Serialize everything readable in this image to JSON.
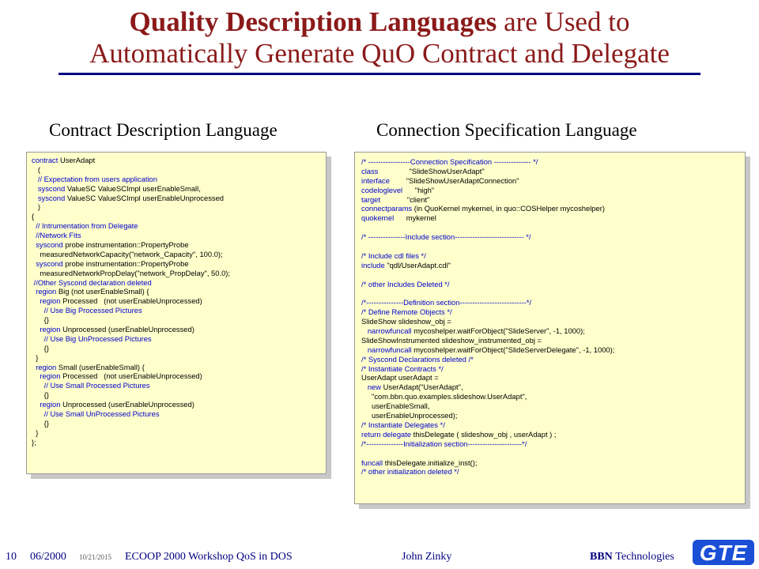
{
  "slide": {
    "title_bold": "Quality Description Languages",
    "title_rest": "are Used to",
    "title_line2": "Automatically Generate QuO Contract and Delegate"
  },
  "left": {
    "heading": "Contract Description Language",
    "lines": [
      [
        [
          "kw",
          "contract "
        ],
        [
          "pl",
          "UserAdapt"
        ]
      ],
      [
        [
          "pl",
          "   ("
        ]
      ],
      [
        [
          "cm",
          "   // Expectation from users application"
        ]
      ],
      [
        [
          "kw",
          "   syscond "
        ],
        [
          "pl",
          "ValueSC ValueSCImpl userEnableSmall,"
        ]
      ],
      [
        [
          "kw",
          "   syscond "
        ],
        [
          "pl",
          "ValueSC ValueSCImpl userEnableUnprocessed"
        ]
      ],
      [
        [
          "pl",
          "   )"
        ]
      ],
      [
        [
          "pl",
          "{"
        ]
      ],
      [
        [
          "cm",
          "  // Intrumentation from Delegate"
        ]
      ],
      [
        [
          "cm",
          "  //Network Fits"
        ]
      ],
      [
        [
          "kw",
          "  syscond "
        ],
        [
          "pl",
          "probe instrumentation::PropertyProbe"
        ]
      ],
      [
        [
          "pl",
          "    measuredNetworkCapacity(\"network_Capacity\", 100.0);"
        ]
      ],
      [
        [
          "kw",
          "  syscond "
        ],
        [
          "pl",
          "probe instrumentation::PropertyProbe"
        ]
      ],
      [
        [
          "pl",
          "    measuredNetworkPropDelay(\"network_PropDelay\", 50.0);"
        ]
      ],
      [
        [
          "cm",
          " //Other Syscond declaration deleted"
        ]
      ],
      [
        [
          "kw",
          "  region "
        ],
        [
          "pl",
          "Big (not userEnableSmall) {"
        ]
      ],
      [
        [
          "kw",
          "    region "
        ],
        [
          "pl",
          "Processed   (not userEnableUnprocessed)"
        ]
      ],
      [
        [
          "cm",
          "      // Use Big Processed Pictures"
        ]
      ],
      [
        [
          "pl",
          "      {}"
        ]
      ],
      [
        [
          "kw",
          "    region "
        ],
        [
          "pl",
          "Unprocessed (userEnableUnprocessed)"
        ]
      ],
      [
        [
          "cm",
          "      // Use Big UnProcessed Pictures"
        ]
      ],
      [
        [
          "pl",
          "      {}"
        ]
      ],
      [
        [
          "pl",
          "  }"
        ]
      ],
      [
        [
          "kw",
          "  region "
        ],
        [
          "pl",
          "Small (userEnableSmall) {"
        ]
      ],
      [
        [
          "kw",
          "    region "
        ],
        [
          "pl",
          "Processed   (not userEnableUnprocessed)"
        ]
      ],
      [
        [
          "cm",
          "      // Use Small Processed Pictures"
        ]
      ],
      [
        [
          "pl",
          "      {}"
        ]
      ],
      [
        [
          "kw",
          "    region "
        ],
        [
          "pl",
          "Unprocessed (userEnableUnprocessed)"
        ]
      ],
      [
        [
          "cm",
          "      // Use Small UnProcessed Pictures"
        ]
      ],
      [
        [
          "pl",
          "      {}"
        ]
      ],
      [
        [
          "pl",
          "  }"
        ]
      ],
      [
        [
          "pl",
          "};"
        ]
      ]
    ]
  },
  "right": {
    "heading": "Connection Specification Language",
    "lines": [
      [
        [
          "cm",
          "/* -----------------Connection Specification --------------- */"
        ]
      ],
      [
        [
          "kw",
          "class "
        ],
        [
          "pl",
          "              \"SlideShowUserAdapt\""
        ]
      ],
      [
        [
          "kw",
          "interface "
        ],
        [
          "pl",
          "       \"SlideShowUserAdaptConnection\""
        ]
      ],
      [
        [
          "kw",
          "codeloglevel "
        ],
        [
          "pl",
          "     \"high\""
        ]
      ],
      [
        [
          "kw",
          "target "
        ],
        [
          "pl",
          "            \"client\""
        ]
      ],
      [
        [
          "kw",
          "connectparams "
        ],
        [
          "pl",
          "(in QuoKernel mykernel, in quo::COSHelper mycoshelper)"
        ]
      ],
      [
        [
          "kw",
          "quokernel "
        ],
        [
          "pl",
          "     mykernel"
        ]
      ],
      [
        [
          "pl",
          " "
        ]
      ],
      [
        [
          "cm",
          "/* ---------------Include section---------------------------- */"
        ]
      ],
      [
        [
          "pl",
          " "
        ]
      ],
      [
        [
          "cm",
          "/* Include cdl files */"
        ]
      ],
      [
        [
          "kw",
          "include "
        ],
        [
          "pl",
          "\"qdl/UserAdapt.cdl\""
        ]
      ],
      [
        [
          "pl",
          " "
        ]
      ],
      [
        [
          "cm",
          "/* other Includes Deleted */"
        ]
      ],
      [
        [
          "pl",
          " "
        ]
      ],
      [
        [
          "cm",
          "/*---------------Definition section---------------------------*/"
        ]
      ],
      [
        [
          "cm",
          "/* Define Remote Objects */"
        ]
      ],
      [
        [
          "pl",
          "SlideShow slideshow_obj ="
        ]
      ],
      [
        [
          "kw",
          "   narrowfuncall "
        ],
        [
          "pl",
          "mycoshelper.waitForObject(\"SlideServer\", -1, 1000);"
        ]
      ],
      [
        [
          "pl",
          "SlideShowInstrumented slideshow_instrumented_obj ="
        ]
      ],
      [
        [
          "kw",
          "   narrowfuncall "
        ],
        [
          "pl",
          "mycoshelper.waitForObject(\"SlideServerDelegate\", -1, 1000);"
        ]
      ],
      [
        [
          "cm",
          "/* Syscond Declarations deleted /*"
        ]
      ],
      [
        [
          "cm",
          "/* Instantiate Contracts */"
        ]
      ],
      [
        [
          "pl",
          "UserAdapt userAdapt ="
        ]
      ],
      [
        [
          "kw",
          "   new "
        ],
        [
          "pl",
          "UserAdapt(\"UserAdapt\","
        ]
      ],
      [
        [
          "pl",
          "     \"com.bbn.quo.examples.slideshow.UserAdapt\","
        ]
      ],
      [
        [
          "pl",
          "     userEnableSmall,"
        ]
      ],
      [
        [
          "pl",
          "     userEnableUnprocessed);"
        ]
      ],
      [
        [
          "cm",
          "/* Instantiate Delegates */"
        ]
      ],
      [
        [
          "kw",
          "return delegate "
        ],
        [
          "pl",
          "thisDelegate ( slideshow_obj , userAdapt ) ;"
        ]
      ],
      [
        [
          "cm",
          "/*---------------Initialization section----------------------*/"
        ]
      ],
      [
        [
          "pl",
          " "
        ]
      ],
      [
        [
          "kw",
          "funcall "
        ],
        [
          "pl",
          "thisDelegate.initialize_inst();"
        ]
      ],
      [
        [
          "cm",
          "/* other initialization deleted */"
        ]
      ]
    ]
  },
  "footer": {
    "page": "10",
    "date": "06/2000",
    "small_date": "10/21/2015",
    "event": "ECOOP 2000 Workshop QoS in DOS",
    "author": "John Zinky",
    "company_bold": "BBN",
    "company_rest": "Technologies",
    "logo_text": "GTE"
  },
  "colors": {
    "title": "#8b1a1a",
    "rule": "#000080",
    "panel_bg": "#ffffcc",
    "keyword": "#0000cc",
    "logo_bg": "#1a4fd6"
  }
}
